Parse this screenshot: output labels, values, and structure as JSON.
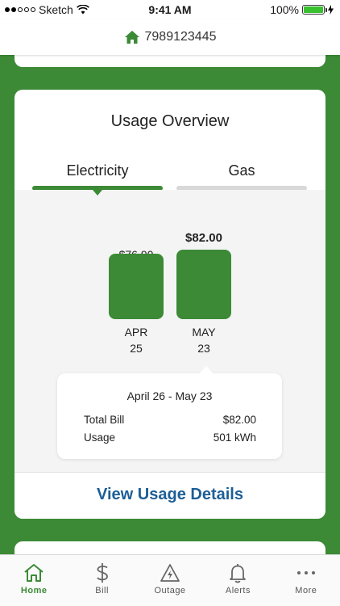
{
  "status_bar": {
    "carrier": "Sketch",
    "time": "9:41 AM",
    "battery": "100%"
  },
  "header": {
    "account_number": "7989123445",
    "icon": "home-icon"
  },
  "usage": {
    "title": "Usage Overview",
    "tabs": [
      {
        "label": "Electricity",
        "active": true
      },
      {
        "label": "Gas",
        "active": false
      }
    ],
    "bars": [
      {
        "value_label": "$76.90",
        "month": "APR",
        "day": "25",
        "value": 76.9
      },
      {
        "value_label": "$82.00",
        "month": "MAY",
        "day": "23",
        "value": 82.0
      }
    ],
    "tooltip": {
      "range": "April 26 - May 23",
      "rows": [
        {
          "label": "Total Bill",
          "value": "$82.00"
        },
        {
          "label": "Usage",
          "value": "501 kWh"
        }
      ]
    },
    "link": "View Usage Details"
  },
  "tabbar": [
    {
      "label": "Home",
      "icon": "home-icon",
      "active": true
    },
    {
      "label": "Bill",
      "icon": "dollar-icon",
      "active": false
    },
    {
      "label": "Outage",
      "icon": "outage-icon",
      "active": false
    },
    {
      "label": "Alerts",
      "icon": "bell-icon",
      "active": false
    },
    {
      "label": "More",
      "icon": "more-icon",
      "active": false
    }
  ],
  "colors": {
    "brand_green": "#3c8a36",
    "link_blue": "#1d5e96",
    "battery_green": "#39c12f"
  }
}
